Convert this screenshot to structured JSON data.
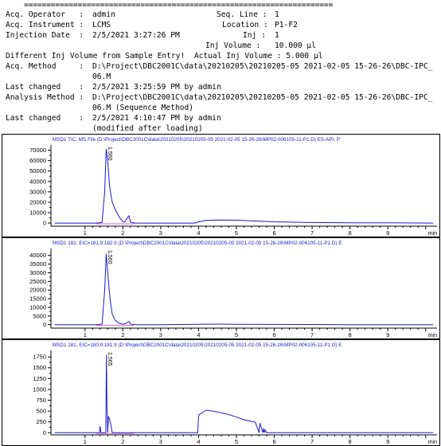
{
  "header": {
    "separator": "=====================================================================",
    "acq_operator": {
      "label": "Acq. Operator   :",
      "value": "admin"
    },
    "seq_line": {
      "label": "Seq. Line :",
      "value": "1"
    },
    "acq_instrument": {
      "label": "Acq. Instrument :",
      "value": "LCMS"
    },
    "location": {
      "label": "Location :",
      "value": "P1-F2"
    },
    "injection_date": {
      "label": "Injection Date  :",
      "value": "2/5/2021 3:27:26 PM"
    },
    "inj": {
      "label": "Inj :",
      "value": "1"
    },
    "inj_volume": {
      "label": "Inj Volume :",
      "value": "10.000 µl"
    },
    "different_inj": "Different Inj Volume from Sample Entry!  Actual Inj Volume : 5.000 µl",
    "acq_method": {
      "label": "Acq. Method     :",
      "value1": "D:\\Project\\DBC2001C\\data\\20210205\\20210205-05 2021-02-05 15-26-26\\DBC-IPC_",
      "value2": "06.M"
    },
    "last_changed_1": {
      "label": "Last changed    :",
      "value": "2/5/2021 3:25:59 PM by admin"
    },
    "analysis_method": {
      "label": "Analysis Method :",
      "value1": "D:\\Project\\DBC2001C\\data\\20210205\\20210205-05 2021-02-05 15-26-26\\DBC-IPC_",
      "value2": "06.M (Sequence Method)"
    },
    "last_changed_2": {
      "label": "Last changed    :",
      "value1": "2/5/2021 4:10:47 PM by admin",
      "value2": "(modified after loading)"
    }
  },
  "chart_data": [
    {
      "type": "line",
      "title": "MSD1 TIC, MS File (D:\\Project\\DBC2001C\\data\\20210205\\20210205-05 2021-02-05 15-26-26\\MP02-006105-11-P1.D)   ES-API, P",
      "xlabel": "min",
      "xlim": [
        0.1,
        10.3
      ],
      "ylim": [
        -3000,
        75000
      ],
      "y_ticks": [
        0,
        10000,
        20000,
        30000,
        40000,
        50000,
        60000,
        70000
      ],
      "x_ticks": [
        1,
        2,
        3,
        4,
        5,
        6,
        7,
        8,
        9
      ],
      "peak_label": "1.560",
      "peak_x": 1.56,
      "color": "#1a1acc",
      "x": [
        0.2,
        1.3,
        1.45,
        1.52,
        1.56,
        1.6,
        1.65,
        1.72,
        1.8,
        1.9,
        2.0,
        2.05,
        2.12,
        2.16,
        2.2,
        2.3,
        2.6,
        3.0,
        3.5,
        3.9,
        4.0,
        4.2,
        4.5,
        5.0,
        5.5,
        6.0,
        7.0,
        8.0,
        9.0,
        10.2
      ],
      "y": [
        0,
        0,
        500,
        30000,
        71000,
        60000,
        35000,
        20000,
        13000,
        6000,
        1500,
        1000,
        5000,
        7000,
        1000,
        0,
        0,
        0,
        0,
        0,
        1200,
        2500,
        3000,
        2800,
        2000,
        1200,
        500,
        300,
        200,
        0
      ]
    },
    {
      "type": "line",
      "title": "MSD1 182, EIC=181.9:182.9 (D:\\Project\\DBC2001C\\data\\20210205\\20210205-05 2021-02-05 15-26-26\\MP02-006105-11-P1.D)   E",
      "xlabel": "min",
      "xlim": [
        0.1,
        10.3
      ],
      "ylim": [
        -2000,
        44000
      ],
      "y_ticks": [
        0,
        5000,
        10000,
        15000,
        20000,
        25000,
        30000,
        35000,
        40000
      ],
      "x_ticks": [
        1,
        2,
        3,
        4,
        5,
        6,
        7,
        8,
        9
      ],
      "peak_label": "1.560",
      "peak_x": 1.56,
      "color": "#1a1acc",
      "x": [
        0.2,
        1.3,
        1.45,
        1.52,
        1.56,
        1.6,
        1.66,
        1.72,
        1.8,
        1.9,
        2.0,
        2.05,
        2.12,
        2.16,
        2.2,
        2.4,
        3.0,
        4.0,
        4.5,
        5.0,
        6.0,
        7.0,
        8.0,
        10.2
      ],
      "y": [
        0,
        0,
        300,
        20000,
        41000,
        30000,
        15000,
        6000,
        2500,
        800,
        300,
        400,
        1200,
        1800,
        300,
        0,
        0,
        200,
        300,
        200,
        100,
        50,
        0,
        0
      ]
    },
    {
      "type": "line",
      "title": "MSD1 181, EIC=180.9:181.9 (D:\\Project\\DBC2001C\\data\\20210205\\20210205-05 2021-02-05 15-26-26\\MP02-006105-11-P1.D)   E",
      "xlabel": "min",
      "xlim": [
        0.1,
        10.3
      ],
      "ylim": [
        -50,
        1900
      ],
      "y_ticks": [
        0,
        250,
        500,
        750,
        1000,
        1250,
        1500,
        1750
      ],
      "x_ticks": [
        1,
        2,
        3,
        4,
        5,
        6,
        7,
        8,
        9
      ],
      "peak_label": "1.565",
      "peak_x": 1.565,
      "color": "#1a1acc",
      "x": [
        0.2,
        1.38,
        1.4,
        1.42,
        1.55,
        1.565,
        1.58,
        1.6,
        1.62,
        1.65,
        1.68,
        1.72,
        1.76,
        1.8,
        3.98,
        4.0,
        4.02,
        4.2,
        4.5,
        4.8,
        5.0,
        5.2,
        5.4,
        5.5,
        5.6,
        5.62,
        5.7,
        5.72,
        5.74,
        5.76,
        5.8,
        10.2
      ],
      "y": [
        0,
        0,
        150,
        0,
        0,
        1800,
        600,
        0,
        380,
        300,
        200,
        0,
        0,
        0,
        0,
        380,
        420,
        520,
        480,
        420,
        360,
        300,
        260,
        240,
        0,
        220,
        0,
        100,
        0,
        60,
        0,
        0
      ]
    }
  ]
}
